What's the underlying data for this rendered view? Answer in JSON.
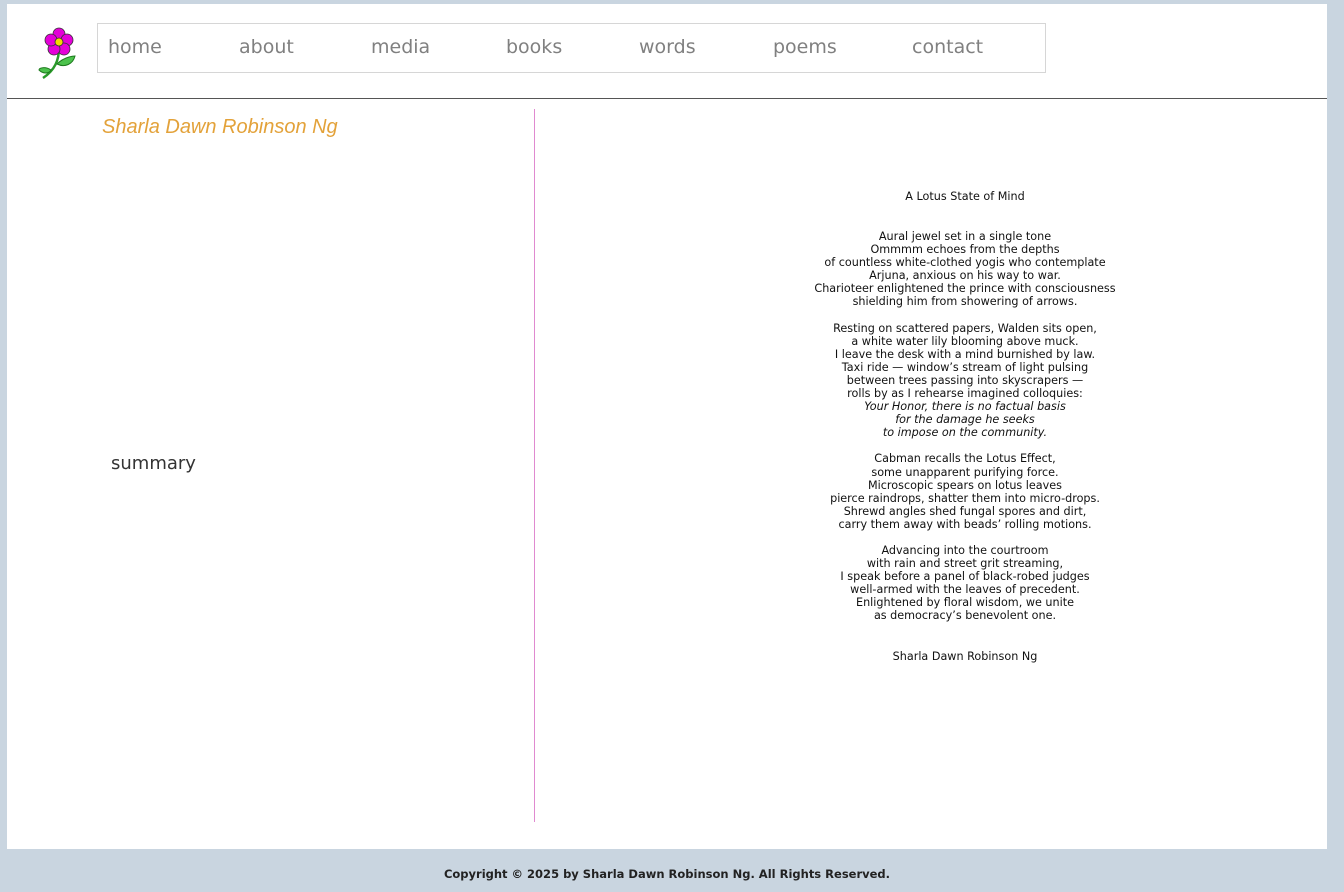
{
  "nav": {
    "items": [
      "home",
      "about",
      "media",
      "books",
      "words",
      "poems",
      "contact"
    ]
  },
  "logo_icon": "flower-icon",
  "header": {
    "author_title": "Sharla Dawn Robinson Ng"
  },
  "sidebar": {
    "summary_label": "summary"
  },
  "poem": {
    "title": "A Lotus State of Mind",
    "stanzas": [
      {
        "lines": [
          {
            "text": "Aural jewel set in a single tone",
            "italic": false
          },
          {
            "text": "Ommmm echoes from the depths",
            "italic": false
          },
          {
            "text": "of countless white-clothed yogis who contemplate",
            "italic": false
          },
          {
            "text": "Arjuna, anxious on his way to war.",
            "italic": false
          },
          {
            "text": "Charioteer enlightened the prince with consciousness",
            "italic": false
          },
          {
            "text": "shielding him from showering of arrows.",
            "italic": false
          }
        ]
      },
      {
        "lines": [
          {
            "text": "Resting on scattered papers, Walden sits open,",
            "italic": false
          },
          {
            "text": "a white water lily blooming above muck.",
            "italic": false
          },
          {
            "text": "I leave the desk with a mind burnished by law.",
            "italic": false
          },
          {
            "text": "Taxi ride — window’s stream of light pulsing",
            "italic": false
          },
          {
            "text": "between trees passing into skyscrapers —",
            "italic": false
          },
          {
            "text": "rolls by as I rehearse imagined colloquies:",
            "italic": false
          },
          {
            "text": "Your Honor, there is no factual basis",
            "italic": true
          },
          {
            "text": "for the damage he seeks",
            "italic": true
          },
          {
            "text": "to impose on the community.",
            "italic": true
          }
        ]
      },
      {
        "lines": [
          {
            "text": "Cabman recalls the Lotus Effect,",
            "italic": false
          },
          {
            "text": "some unapparent purifying force.",
            "italic": false
          },
          {
            "text": "Microscopic spears on lotus leaves",
            "italic": false
          },
          {
            "text": "pierce raindrops, shatter them into micro-drops.",
            "italic": false
          },
          {
            "text": "Shrewd angles shed fungal spores and dirt,",
            "italic": false
          },
          {
            "text": "carry them away with beads’ rolling motions.",
            "italic": false
          }
        ]
      },
      {
        "lines": [
          {
            "text": "Advancing into the courtroom",
            "italic": false
          },
          {
            "text": "with rain and street grit streaming,",
            "italic": false
          },
          {
            "text": "I speak before a panel of black-robed judges",
            "italic": false
          },
          {
            "text": "well-armed with the leaves of precedent.",
            "italic": false
          },
          {
            "text": "Enlightened by floral wisdom, we unite",
            "italic": false
          },
          {
            "text": "as democracy’s benevolent one.",
            "italic": false
          }
        ]
      }
    ],
    "author": "Sharla Dawn Robinson Ng"
  },
  "footer": {
    "copyright": "Copyright © 2025 by Sharla Dawn Robinson Ng. All Rights Reserved."
  },
  "colors": {
    "background": "#c9d5e0",
    "author_title": "#e3a23a",
    "divider": "#e08ad0",
    "nav_text": "#808080"
  }
}
